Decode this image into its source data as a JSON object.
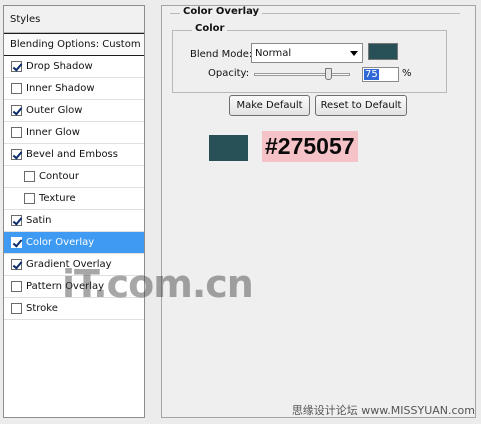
{
  "styles_panel": {
    "header": "Styles",
    "blending_options": "Blending Options: Custom",
    "items": [
      {
        "label": "Drop Shadow",
        "checked": true,
        "indent": false,
        "selected": false
      },
      {
        "label": "Inner Shadow",
        "checked": false,
        "indent": false,
        "selected": false
      },
      {
        "label": "Outer Glow",
        "checked": true,
        "indent": false,
        "selected": false
      },
      {
        "label": "Inner Glow",
        "checked": false,
        "indent": false,
        "selected": false
      },
      {
        "label": "Bevel and Emboss",
        "checked": true,
        "indent": false,
        "selected": false
      },
      {
        "label": "Contour",
        "checked": false,
        "indent": true,
        "selected": false
      },
      {
        "label": "Texture",
        "checked": false,
        "indent": true,
        "selected": false
      },
      {
        "label": "Satin",
        "checked": true,
        "indent": false,
        "selected": false
      },
      {
        "label": "Color Overlay",
        "checked": true,
        "indent": false,
        "selected": true
      },
      {
        "label": "Gradient Overlay",
        "checked": true,
        "indent": false,
        "selected": false
      },
      {
        "label": "Pattern Overlay",
        "checked": false,
        "indent": false,
        "selected": false
      },
      {
        "label": "Stroke",
        "checked": false,
        "indent": false,
        "selected": false
      }
    ]
  },
  "color_overlay": {
    "section_title": "Color Overlay",
    "group_title": "Color",
    "blend_mode_label": "Blend Mode:",
    "blend_mode_value": "Normal",
    "swatch_color": "#275057",
    "opacity_label": "Opacity:",
    "opacity_value": "75",
    "opacity_unit": "%",
    "make_default_label": "Make Default",
    "reset_default_label": "Reset to Default"
  },
  "annotation": {
    "swatch_color": "#275057",
    "hex_text": "#275057",
    "highlight_color": "#f5c2c7"
  },
  "watermarks": {
    "logo_text": "iT.com.cn",
    "site_text": "思缘设计论坛 www.MISSYUAN.com"
  }
}
